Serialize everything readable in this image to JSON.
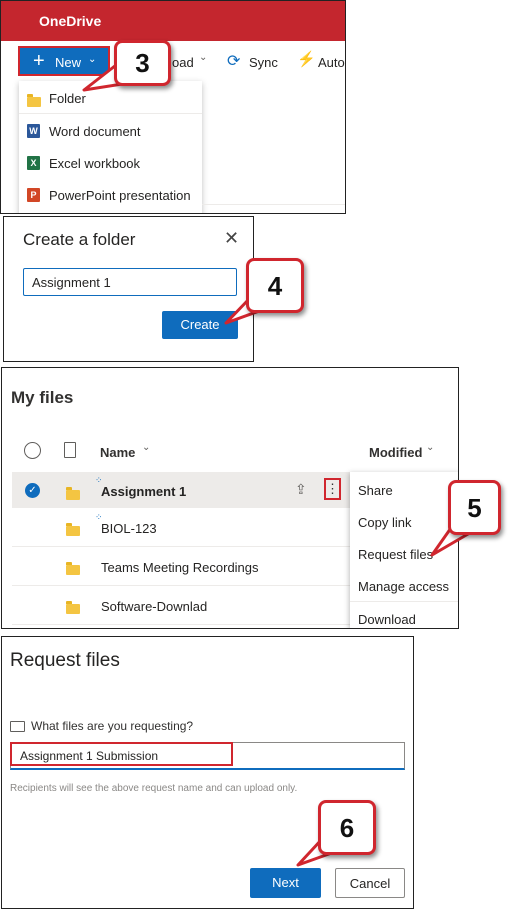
{
  "panel1": {
    "app_title": "OneDrive",
    "toolbar": {
      "new_label": "New",
      "upload_label": "oad",
      "sync_label": "Sync",
      "auto_label": "Auto"
    },
    "menu": [
      "Folder",
      "Word document",
      "Excel workbook",
      "PowerPoint presentation"
    ],
    "callout": "3"
  },
  "panel2": {
    "title": "Create a folder",
    "input_value": "Assignment 1",
    "create_label": "Create",
    "callout": "4"
  },
  "panel3": {
    "title": "My files",
    "col_name": "Name",
    "col_modified": "Modified",
    "rows": [
      "Assignment 1",
      "BIOL-123",
      "Teams Meeting Recordings",
      "Software-Downlad"
    ],
    "context_menu": [
      "Share",
      "Copy link",
      "Request files",
      "Manage access",
      "Download"
    ],
    "callout": "5"
  },
  "panel4": {
    "title": "Request files",
    "question": "What files are you requesting?",
    "input_value": "Assignment 1 Submission",
    "hint": "Recipients will see the above request name and can upload only.",
    "next_label": "Next",
    "cancel_label": "Cancel",
    "callout": "6"
  },
  "colors": {
    "onedrive_red": "#c4262e",
    "primary_blue": "#0f6cbd",
    "callout_red": "#d0262e"
  }
}
